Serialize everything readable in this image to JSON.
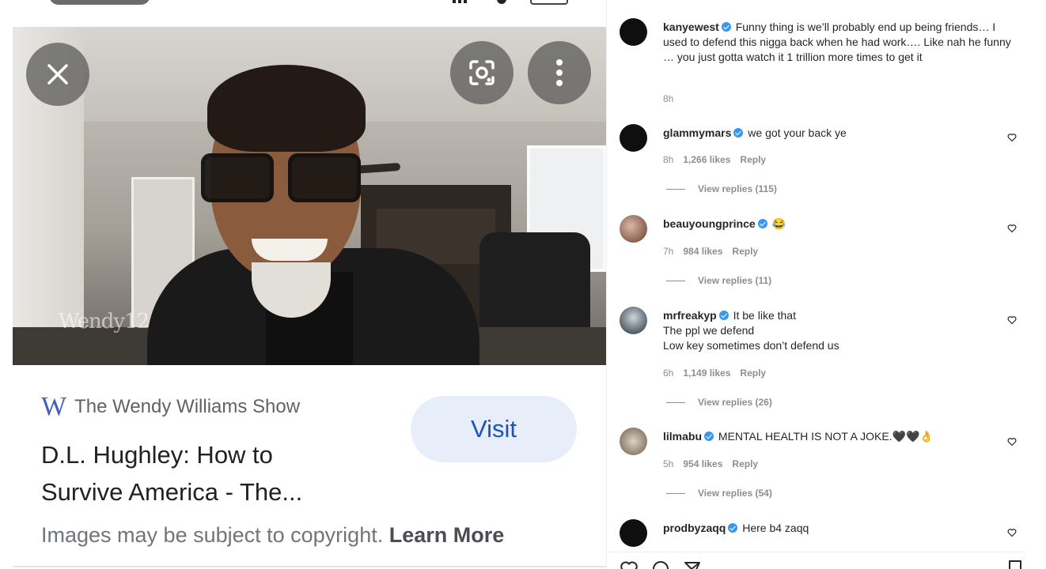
{
  "google_viewer": {
    "watermark": "Wendy12",
    "source_logo": "W",
    "source_name": "The Wendy Williams Show",
    "title_line1": "D.L. Hughley: How to",
    "title_line2": "Survive America - The...",
    "visit_label": "Visit",
    "copyright_text": "Images may be subject to copyright.",
    "learn_more_label": "Learn More"
  },
  "instagram": {
    "comments": [
      {
        "username": "kanyewest",
        "text": "Funny thing is we’ll probably end up being friends… I used to defend this nigga back when he had work…. Like nah he funny … you just gotta watch it 1 trillion more times to get it",
        "time": "8h"
      },
      {
        "username": "glammymars",
        "text": "we got your back ye",
        "time": "8h",
        "likes": "1,266 likes",
        "reply": "Reply",
        "view_replies": "View replies (115)"
      },
      {
        "username": "beauyoungprince",
        "text": "😂",
        "time": "7h",
        "likes": "984 likes",
        "reply": "Reply",
        "view_replies": "View replies (11)"
      },
      {
        "username": "mrfreakyp",
        "text_line1": "It be like that",
        "text_line2": "The ppl we defend",
        "text_line3": "Low key sometimes don’t defend us",
        "time": "6h",
        "likes": "1,149 likes",
        "reply": "Reply",
        "view_replies": "View replies (26)"
      },
      {
        "username": "lilmabu",
        "text": "MENTAL HEALTH IS NOT A JOKE.🖤🖤👌",
        "time": "5h",
        "likes": "954 likes",
        "reply": "Reply",
        "view_replies": "View replies (54)"
      },
      {
        "username": "prodbyzaqq",
        "text": "Here b4 zaqq"
      }
    ],
    "colors": {
      "verified": "#3897f0",
      "meta": "#8e8e8e",
      "text": "#262626"
    }
  }
}
